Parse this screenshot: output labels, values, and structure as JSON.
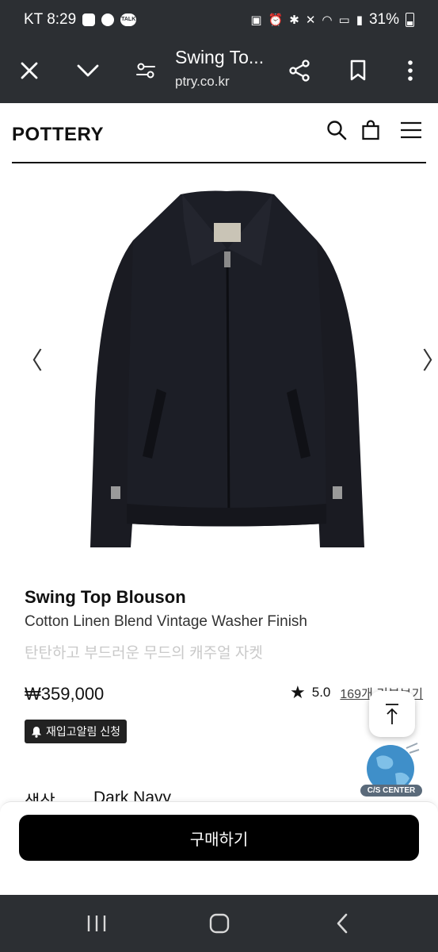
{
  "status_bar": {
    "carrier_time": "KT 8:29",
    "talk_label": "TALK",
    "battery": "31%"
  },
  "browser": {
    "title": "Swing To...",
    "host": "ptry.co.kr"
  },
  "site": {
    "logo": "POTTERY"
  },
  "gallery": {
    "prev": "〈",
    "next": "〉"
  },
  "product": {
    "name": "Swing Top Blouson",
    "subtitle": "Cotton Linen Blend Vintage Washer Finish",
    "description": "탄탄하고 부드러운 무드의 캐주얼 자켓",
    "price": "₩359,000",
    "rating_score": "5.0",
    "review_link": "169개 리뷰보기",
    "restock_label": "재입고알림 신청",
    "option_label": "색상",
    "option_value": "Dark Navy"
  },
  "floating": {
    "cs_label": "C/S CENTER"
  },
  "buy": {
    "label": "구매하기"
  },
  "colors": {
    "system_bar": "#2c2f33",
    "buy_button": "#000000",
    "jacket": "#1a1b22"
  }
}
